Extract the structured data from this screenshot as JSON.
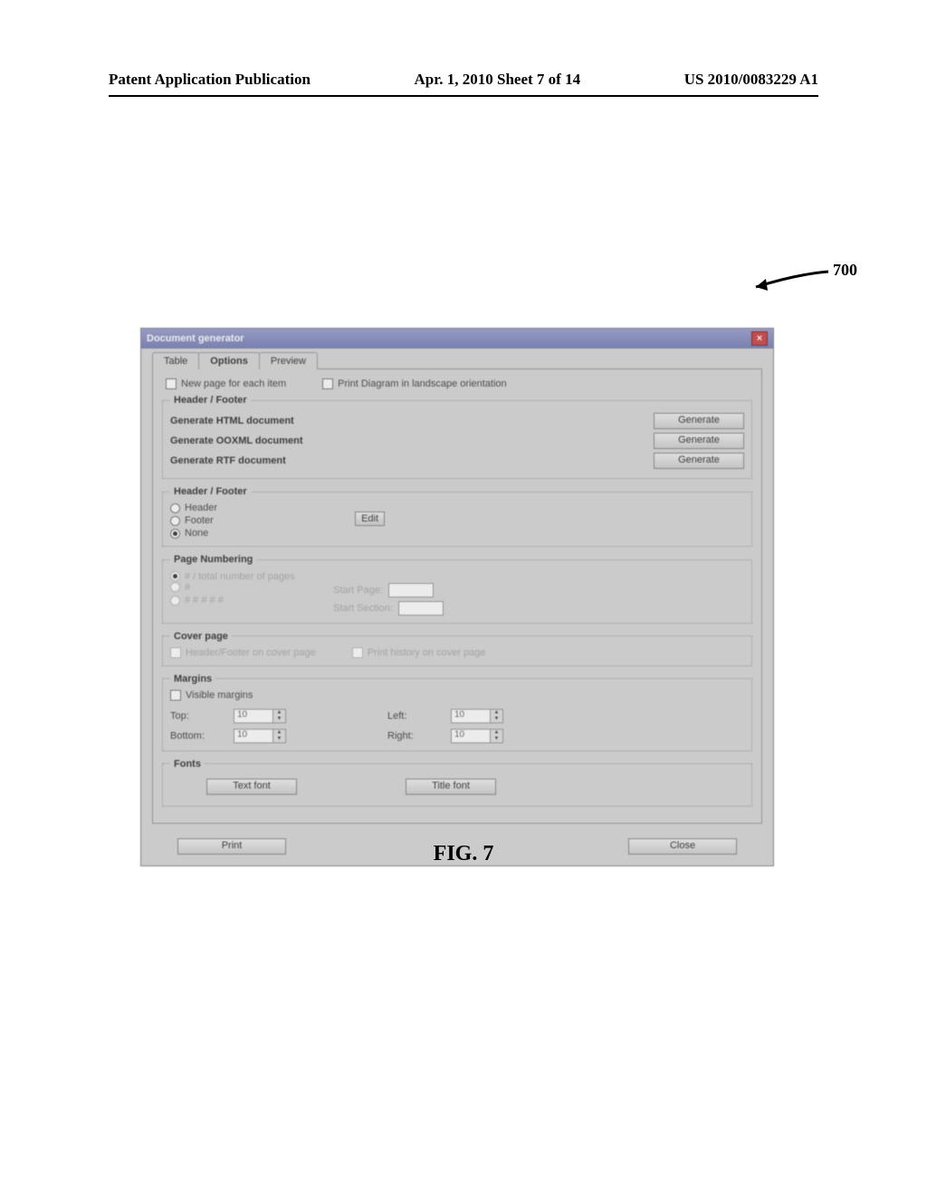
{
  "header": {
    "left": "Patent Application Publication",
    "mid": "Apr. 1, 2010  Sheet 7 of 14",
    "right": "US 2010/0083229 A1"
  },
  "ref_number": "700",
  "window": {
    "title": "Document generator",
    "close": "×",
    "tabs": [
      "Table",
      "Options",
      "Preview"
    ],
    "new_page": "New page for each item",
    "landscape": "Print Diagram in landscape orientation",
    "gen_group_legend": "Header / Footer",
    "gen_html": "Generate HTML document",
    "gen_ooxml": "Generate OOXML document",
    "gen_rtf": "Generate RTF document",
    "generate_btn": "Generate",
    "hf_legend": "Header / Footer",
    "hf_header": "Header",
    "hf_footer": "Footer",
    "hf_none": "None",
    "edit_btn": "Edit",
    "pn_legend": "Page Numbering",
    "pn_opt1": "# / total number of pages",
    "pn_opt2": "#",
    "pn_opt3": "# # # # #",
    "start_page_lbl": "Start Page:",
    "start_section_lbl": "Start Section:",
    "start_page_val": "",
    "start_section_val": "",
    "cover_legend": "Cover page",
    "cover_hf": "Header/Footer on cover page",
    "cover_hist": "Print history on cover page",
    "margins_legend": "Margins",
    "visible_margins": "Visible margins",
    "top_lbl": "Top:",
    "bottom_lbl": "Bottom:",
    "left_lbl": "Left:",
    "right_lbl": "Right:",
    "margin_val": "10",
    "fonts_legend": "Fonts",
    "text_font_btn": "Text font",
    "title_font_btn": "Title font",
    "print_btn": "Print",
    "close_btn": "Close"
  },
  "figure_caption": "FIG. 7"
}
